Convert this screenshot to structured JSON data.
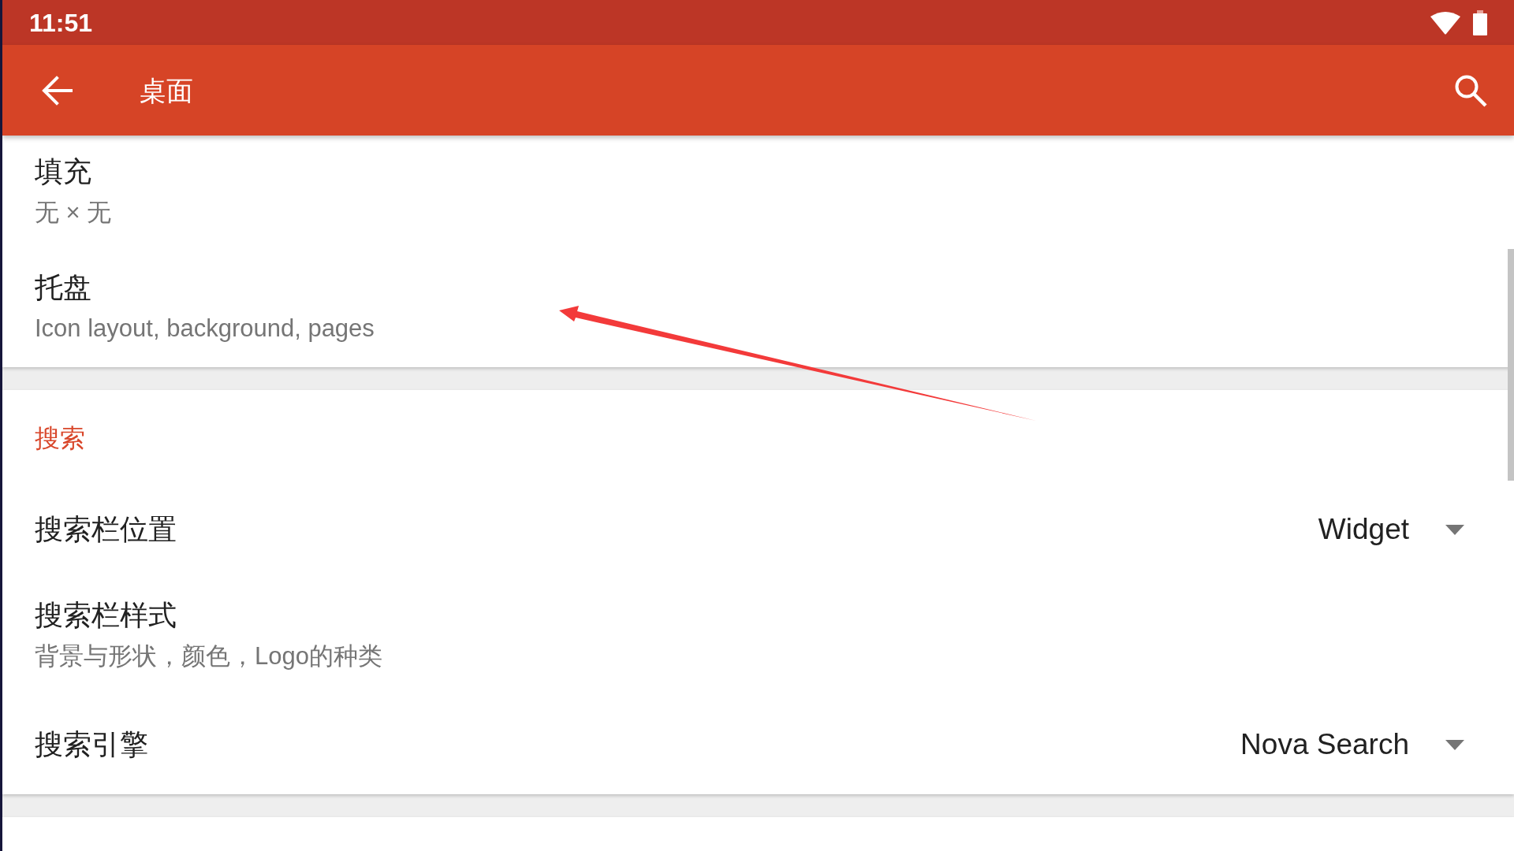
{
  "status_bar": {
    "time": "11:51"
  },
  "app_bar": {
    "title": "桌面"
  },
  "sections": [
    {
      "items": [
        {
          "kind": "summary",
          "title": "填充",
          "summary": "无 × 无"
        },
        {
          "kind": "summary",
          "title": "托盘",
          "summary": "Icon layout, background, pages"
        }
      ]
    },
    {
      "header": "搜索",
      "items": [
        {
          "kind": "dropdown",
          "title": "搜索栏位置",
          "value": "Widget"
        },
        {
          "kind": "summary",
          "title": "搜索栏样式",
          "summary": "背景与形状，颜色，Logo的种类"
        },
        {
          "kind": "dropdown",
          "title": "搜索引擎",
          "value": "Nova Search"
        }
      ]
    }
  ]
}
